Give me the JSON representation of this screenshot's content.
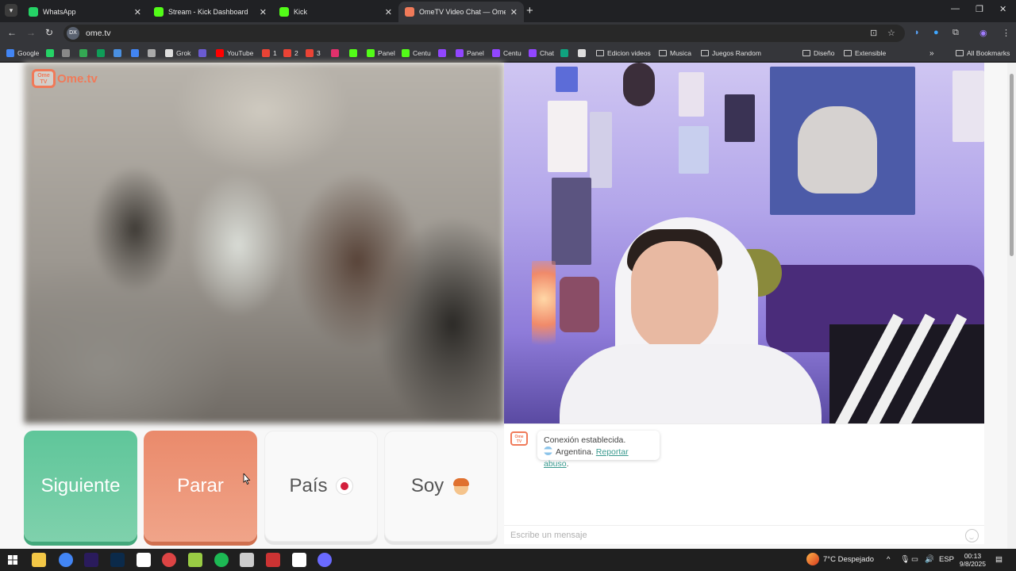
{
  "browser": {
    "tabs": [
      {
        "title": "WhatsApp",
        "fav_color": "#25d366",
        "active": false
      },
      {
        "title": "Stream - Kick Dashboard",
        "fav_color": "#53fc18",
        "active": false
      },
      {
        "title": "Kick",
        "fav_color": "#53fc18",
        "active": false
      },
      {
        "title": "OmeTV Video Chat — Ome",
        "fav_color": "#f07a59",
        "active": true
      }
    ],
    "url": "ome.tv",
    "site_icon": "DX",
    "bookmarks": [
      {
        "label": "Google",
        "color": "#4285f4"
      },
      {
        "label": "",
        "color": "#25d366"
      },
      {
        "label": "",
        "color": "#888888"
      },
      {
        "label": "",
        "color": "#34a853"
      },
      {
        "label": "",
        "color": "#0f9d58"
      },
      {
        "label": "",
        "color": "#4a90e2"
      },
      {
        "label": "",
        "color": "#4285f4"
      },
      {
        "label": "",
        "color": "#aaaaaa"
      },
      {
        "label": "Grok",
        "color": "#dddddd"
      },
      {
        "label": "",
        "color": "#6b5bd2"
      },
      {
        "label": "YouTube",
        "color": "#ff0000"
      },
      {
        "label": "1",
        "color": "#ea4335"
      },
      {
        "label": "2",
        "color": "#ea4335"
      },
      {
        "label": "3",
        "color": "#ea4335"
      },
      {
        "label": "",
        "color": "#e1306c"
      },
      {
        "label": "",
        "color": "#53fc18"
      },
      {
        "label": "Panel",
        "color": "#53fc18"
      },
      {
        "label": "Centu",
        "color": "#53fc18"
      },
      {
        "label": "",
        "color": "#9146ff"
      },
      {
        "label": "Panel",
        "color": "#9146ff"
      },
      {
        "label": "Centu",
        "color": "#9146ff"
      },
      {
        "label": "Chat",
        "color": "#9146ff"
      },
      {
        "label": "",
        "color": "#10a37f"
      },
      {
        "label": "",
        "color": "#dddddd"
      }
    ],
    "folders": [
      "Edicion videos",
      "Musica",
      "Juegos Random",
      "Diseño",
      "Extensible"
    ],
    "all_bookmarks": "All Bookmarks"
  },
  "site": {
    "brand_badge": "Ome TV",
    "brand_name": "Ome.tv",
    "buttons": {
      "next": "Siguiente",
      "stop": "Parar",
      "country": "País",
      "gender": "Soy"
    },
    "chat": {
      "logo_text": "Ome TV",
      "status": "Conexión establecida.",
      "country": "Argentina.",
      "report_link": "Reportar abuso",
      "report_suffix": ".",
      "placeholder": "Escribe un mensaje"
    }
  },
  "taskbar": {
    "weather": "7°C  Despejado",
    "lang": "ESP",
    "time": "00:13",
    "date": "9/8/2025",
    "apps": [
      {
        "name": "file-explorer",
        "color": "#f3c746"
      },
      {
        "name": "chrome",
        "color": "#4285f4"
      },
      {
        "name": "premiere",
        "color": "#2a1b5c"
      },
      {
        "name": "photoshop",
        "color": "#0b2a4a"
      },
      {
        "name": "notion",
        "color": "#ffffff"
      },
      {
        "name": "obs",
        "color": "#d44"
      },
      {
        "name": "android",
        "color": "#9c4"
      },
      {
        "name": "spotify",
        "color": "#1db954"
      },
      {
        "name": "settings",
        "color": "#cccccc"
      },
      {
        "name": "voice-meeter",
        "color": "#c33"
      },
      {
        "name": "capcut",
        "color": "#ffffff"
      },
      {
        "name": "app-circle",
        "color": "#6a6aff"
      }
    ]
  }
}
